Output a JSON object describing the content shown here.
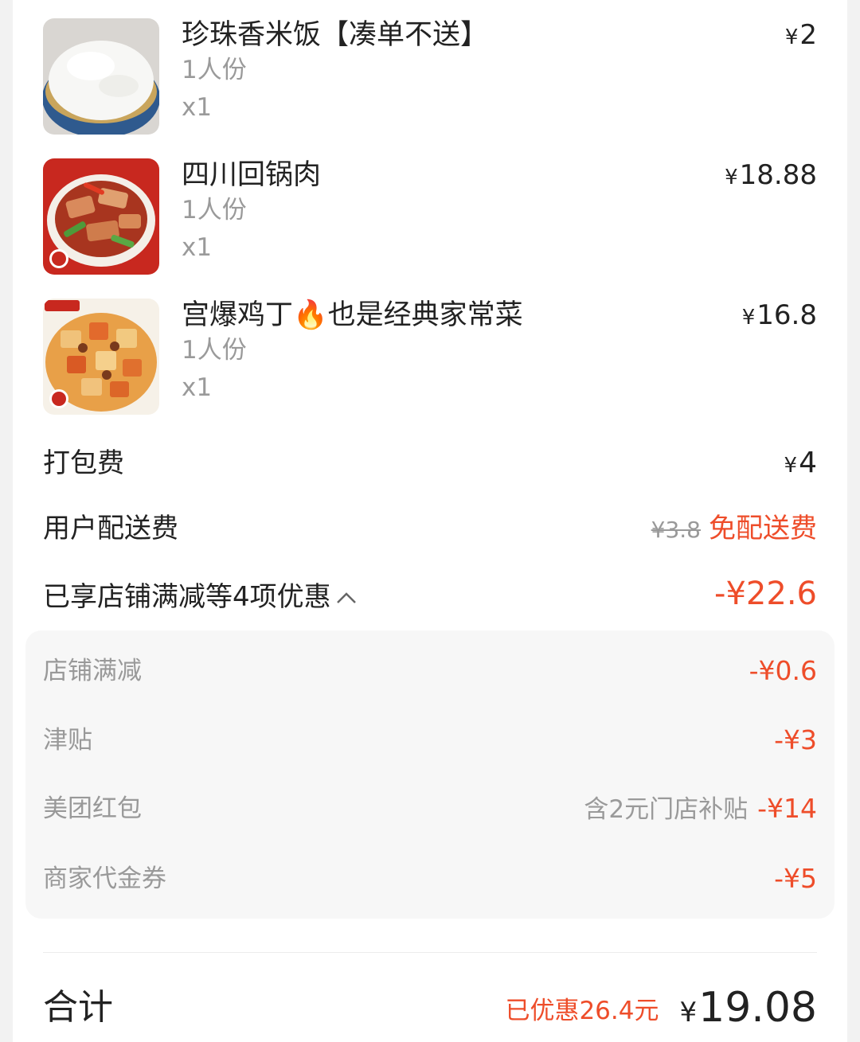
{
  "items": [
    {
      "name": "珍珠香米饭【凑单不送】",
      "spec": "1人份",
      "qty": "x1",
      "currency": "¥",
      "price": "2",
      "image_icon": "rice-bowl-image"
    },
    {
      "name": "四川回锅肉",
      "spec": "1人份",
      "qty": "x1",
      "currency": "¥",
      "price": "18.88",
      "image_icon": "twice-cooked-pork-image"
    },
    {
      "name": "宫爆鸡丁🔥也是经典家常菜",
      "spec": "1人份",
      "qty": "x1",
      "currency": "¥",
      "price": "16.8",
      "image_icon": "kung-pao-chicken-image"
    }
  ],
  "packing_fee": {
    "label": "打包费",
    "currency": "¥",
    "value": "4"
  },
  "delivery_fee": {
    "label": "用户配送费",
    "original": "¥3.8",
    "free_text": "免配送费"
  },
  "discount_summary": {
    "label": "已享店铺满减等4项优惠",
    "value": "-¥22.6",
    "icon": "chevron-up-icon"
  },
  "discounts": [
    {
      "label": "店铺满减",
      "note": "",
      "value": "-¥0.6"
    },
    {
      "label": "津贴",
      "note": "",
      "value": "-¥3"
    },
    {
      "label": "美团红包",
      "note": "含2元门店补贴",
      "value": "-¥14"
    },
    {
      "label": "商家代金券",
      "note": "",
      "value": "-¥5"
    }
  ],
  "total": {
    "label": "合计",
    "saved": "已优惠26.4元",
    "currency": "¥",
    "value": "19.08"
  },
  "colors": {
    "accent_red": "#ee4d2a",
    "text": "#222222",
    "muted": "#999999"
  }
}
